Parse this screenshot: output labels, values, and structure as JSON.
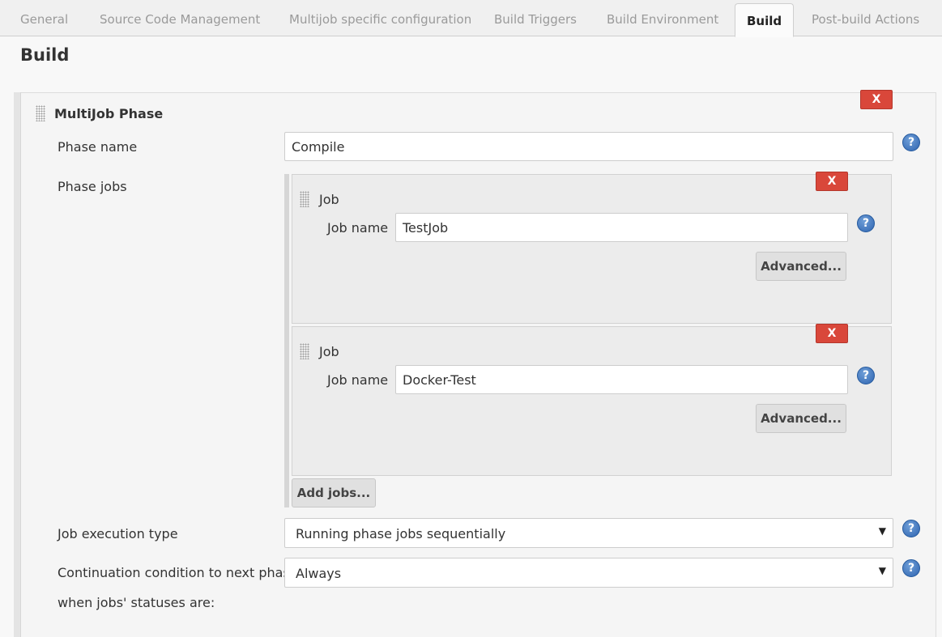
{
  "tabs": [
    {
      "label": "General",
      "active": false
    },
    {
      "label": "Source Code Management",
      "active": false
    },
    {
      "label": "Multijob specific configuration",
      "active": false
    },
    {
      "label": "Build Triggers",
      "active": false
    },
    {
      "label": "Build Environment",
      "active": false
    },
    {
      "label": "Build",
      "active": true
    },
    {
      "label": "Post-build Actions",
      "active": false
    }
  ],
  "section_title": "Build",
  "phase": {
    "title": "MultiJob Phase",
    "delete_label": "X",
    "phase_name_label": "Phase name",
    "phase_name_value": "Compile",
    "phase_jobs_label": "Phase jobs",
    "jobs": [
      {
        "title": "Job",
        "job_name_label": "Job name",
        "job_name_value": "TestJob",
        "advanced_label": "Advanced...",
        "delete_label": "X"
      },
      {
        "title": "Job",
        "job_name_label": "Job name",
        "job_name_value": "Docker-Test",
        "advanced_label": "Advanced...",
        "delete_label": "X"
      }
    ],
    "add_jobs_label": "Add jobs...",
    "execution_type_label": "Job execution type",
    "execution_type_value": "Running phase jobs sequentially",
    "continuation_label_line1": "Continuation condition to next phase",
    "continuation_label_line2": "when jobs' statuses are:",
    "continuation_value": "Always"
  },
  "help_glyph": "?",
  "caret_glyph": "▼",
  "colors": {
    "delete_red": "#d9473a",
    "help_blue": "#2f64b0"
  }
}
